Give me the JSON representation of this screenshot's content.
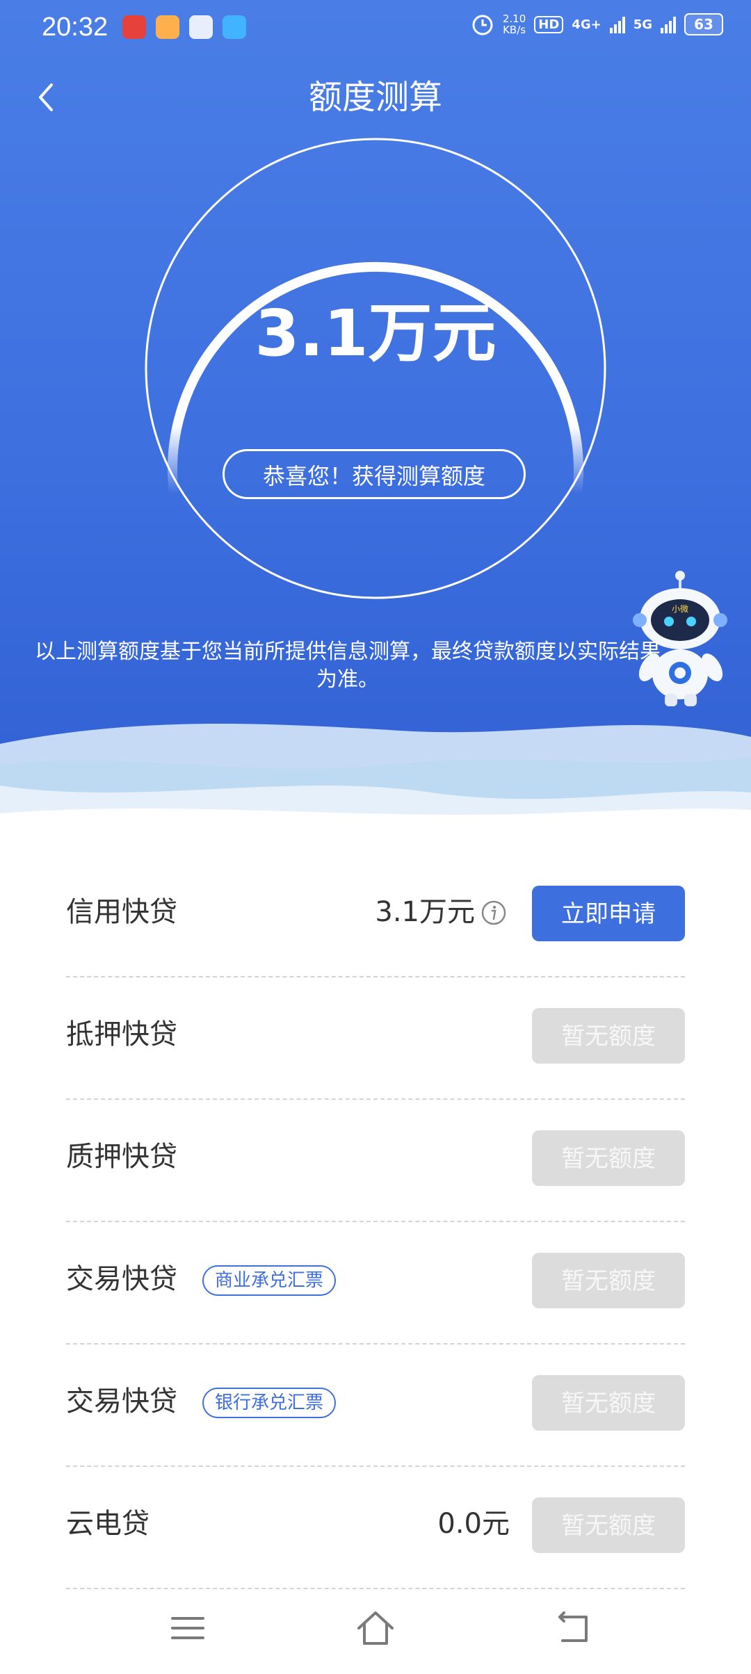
{
  "status_bar": {
    "time": "20:32",
    "network_speed_top": "2.10",
    "network_speed_unit": "KB/s",
    "hd": "HD",
    "signal_4g": "4G+",
    "signal_5g": "5G",
    "battery": "63"
  },
  "nav": {
    "title": "额度测算"
  },
  "result": {
    "amount": "3.1万元",
    "badge": "恭喜您！获得测算额度",
    "disclaimer": "以上测算额度基于您当前所提供信息测算，最终贷款额度以实际结果为准。",
    "mascot_tag": "小微"
  },
  "loans": [
    {
      "label": "信用快贷",
      "amount": "3.1万元",
      "button": "立即申请"
    },
    {
      "label": "抵押快贷",
      "button": "暂无额度"
    },
    {
      "label": "质押快贷",
      "button": "暂无额度"
    },
    {
      "label": "交易快贷",
      "tag": "商业承兑汇票",
      "button": "暂无额度"
    },
    {
      "label": "交易快贷",
      "tag": "银行承兑汇票",
      "button": "暂无额度"
    },
    {
      "label": "云电贷",
      "amount": "0.0元",
      "button": "暂无额度"
    }
  ]
}
